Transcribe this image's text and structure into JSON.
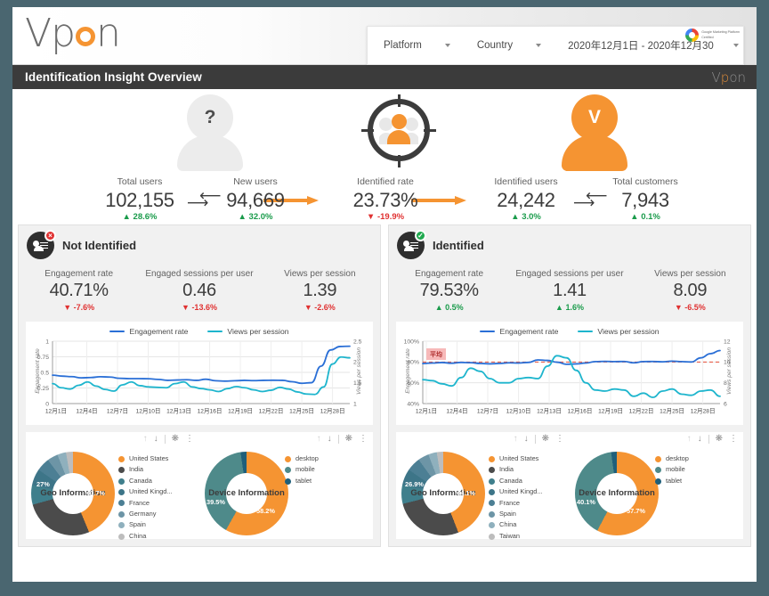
{
  "brand": {
    "logo": "Vpon",
    "accent": "#f59432",
    "title_logo": "Vpon"
  },
  "header": {
    "certification": {
      "line1": "Google Marketing Platform",
      "line2": "Certified"
    },
    "filters": [
      {
        "name": "platform",
        "label": "Platform"
      },
      {
        "name": "country",
        "label": "Country"
      },
      {
        "name": "date-range",
        "label": "2020年12月1日 - 2020年12月30"
      }
    ]
  },
  "page_title": "Identification Insight Overview",
  "funnel": {
    "icons": [
      {
        "name": "unknown-user-icon",
        "glyph": "?"
      },
      {
        "name": "targeted-users-icon",
        "glyph": ""
      },
      {
        "name": "identified-user-icon",
        "glyph": "V"
      }
    ],
    "kpis": [
      {
        "label": "Total users",
        "value": "102,155",
        "delta": "28.6%",
        "dir": "up"
      },
      {
        "label": "New users",
        "value": "94,669",
        "delta": "32.0%",
        "dir": "up"
      },
      {
        "label": "Identified rate",
        "value": "23.73%",
        "delta": "-19.9%",
        "dir": "down"
      },
      {
        "label": "Identified users",
        "value": "24,242",
        "delta": "3.0%",
        "dir": "up"
      },
      {
        "label": "Total customers",
        "value": "7,943",
        "delta": "0.1%",
        "dir": "up"
      }
    ]
  },
  "panels": [
    {
      "id": "not-identified",
      "title": "Not Identified",
      "status": "x",
      "kpis": [
        {
          "label": "Engagement rate",
          "value": "40.71%",
          "delta": "-7.6%",
          "dir": "down"
        },
        {
          "label": "Engaged sessions per user",
          "value": "0.46",
          "delta": "-13.6%",
          "dir": "down"
        },
        {
          "label": "Views per session",
          "value": "1.39",
          "delta": "-2.6%",
          "dir": "down"
        }
      ],
      "chart_data": {
        "type": "line",
        "title": "",
        "legend": [
          "Engagement rate",
          "Views per session"
        ],
        "legend_position": "top",
        "grid": true,
        "xlabel": "",
        "ylabel": "Engagement rate",
        "y2label": "Views per session",
        "ylim": [
          0,
          1
        ],
        "yticks": [
          "0",
          "0.25",
          "0.5",
          "0.75",
          "1"
        ],
        "y2lim": [
          1,
          2.5
        ],
        "y2ticks": [
          "1",
          "1.5",
          "2",
          "2.5"
        ],
        "xticks": [
          "12月1日",
          "12月4日",
          "12月7日",
          "12月10日",
          "12月13日",
          "12月16日",
          "12月19日",
          "12月22日",
          "12月25日",
          "12月28日"
        ],
        "series": [
          {
            "name": "Engagement rate",
            "color": "#2a6fd6",
            "values": [
              0.455,
              0.44,
              0.432,
              0.412,
              0.418,
              0.43,
              0.425,
              0.405,
              0.4,
              0.4,
              0.398,
              0.388,
              0.372,
              0.378,
              0.382,
              0.372,
              0.39,
              0.366,
              0.36,
              0.366,
              0.372,
              0.368,
              0.372,
              0.374,
              0.372,
              0.35,
              0.325,
              0.335,
              0.6,
              0.86,
              0.915,
              0.92
            ]
          },
          {
            "name": "Views per session",
            "color": "#1eb5cd",
            "values": [
              1.48,
              1.38,
              1.35,
              1.44,
              1.52,
              1.42,
              1.34,
              1.3,
              1.45,
              1.52,
              1.43,
              1.4,
              1.39,
              1.38,
              1.48,
              1.52,
              1.4,
              1.36,
              1.33,
              1.29,
              1.36,
              1.41,
              1.38,
              1.33,
              1.29,
              1.32,
              1.39,
              1.35,
              1.28,
              1.23,
              1.22,
              1.4,
              1.95,
              2.12,
              2.1
            ]
          }
        ]
      },
      "geo": {
        "title": "Geo Information",
        "chart_data": {
          "type": "pie",
          "title": "Geo Information",
          "labels": [
            "United States",
            "India",
            "Canada",
            "United Kingd...",
            "France",
            "Germany",
            "Spain",
            "China"
          ],
          "values": [
            43.7,
            27.0,
            7.6,
            6.3,
            5.2,
            4.1,
            3.4,
            2.7
          ],
          "annotations": [
            "43.7%",
            "27%"
          ],
          "colors": [
            "#f59432",
            "#4b4b4b",
            "#3f7f8c",
            "#3d7588",
            "#4c7f94",
            "#6d95a6",
            "#8fb0bd",
            "#bdbdbd"
          ]
        }
      },
      "device": {
        "title": "Device Information",
        "chart_data": {
          "type": "pie",
          "title": "Device Information",
          "labels": [
            "desktop",
            "mobile",
            "tablet"
          ],
          "values": [
            58.2,
            39.5,
            2.3
          ],
          "annotations": [
            "58.2%",
            "39.5%"
          ],
          "colors": [
            "#f59432",
            "#4e8a8a",
            "#1f5f7a"
          ]
        }
      }
    },
    {
      "id": "identified",
      "title": "Identified",
      "status": "ok",
      "kpis": [
        {
          "label": "Engagement rate",
          "value": "79.53%",
          "delta": "0.5%",
          "dir": "up"
        },
        {
          "label": "Engaged sessions per user",
          "value": "1.41",
          "delta": "1.6%",
          "dir": "up"
        },
        {
          "label": "Views per session",
          "value": "8.09",
          "delta": "-6.5%",
          "dir": "down"
        }
      ],
      "chart_data": {
        "type": "line",
        "title": "",
        "legend": [
          "Engagement rate",
          "Views per session"
        ],
        "legend_position": "top",
        "grid": true,
        "average_label": "平均",
        "average_value": 80,
        "xlabel": "",
        "ylabel": "Engagement rate",
        "y2label": "Views per session",
        "ylim": [
          40,
          100
        ],
        "yticks": [
          "40%",
          "60%",
          "80%",
          "100%"
        ],
        "y2lim": [
          6,
          12
        ],
        "y2ticks": [
          "6",
          "8",
          "10",
          "12"
        ],
        "xticks": [
          "12月1日",
          "12月4日",
          "12月7日",
          "12月10日",
          "12月13日",
          "12月16日",
          "12月19日",
          "12月22日",
          "12月25日",
          "12月28日"
        ],
        "series": [
          {
            "name": "Engagement rate",
            "color": "#2a6fd6",
            "values": [
              78.5,
              79.0,
              79.5,
              78.8,
              79.6,
              79.3,
              78.6,
              78.2,
              78.6,
              79.2,
              79.0,
              79.6,
              82.0,
              81.5,
              79.8,
              77.8,
              78.2,
              79.0,
              80.4,
              80.6,
              80.4,
              80.5,
              79.2,
              80.4,
              80.5,
              80.2,
              80.8,
              80.4,
              80.0,
              84.0,
              88.0,
              91.0
            ]
          },
          {
            "name": "Views per session",
            "color": "#1eb5cd",
            "values": [
              8.3,
              8.2,
              7.9,
              7.7,
              8.5,
              9.4,
              9.1,
              8.4,
              8.0,
              8.0,
              8.4,
              8.5,
              8.4,
              9.6,
              10.6,
              10.4,
              9.2,
              8.0,
              7.3,
              7.2,
              7.4,
              7.3,
              6.7,
              7.0,
              6.6,
              7.2,
              7.4,
              6.9,
              6.8,
              7.2,
              7.3,
              6.7
            ]
          }
        ]
      },
      "geo": {
        "title": "Geo Information",
        "chart_data": {
          "type": "pie",
          "title": "Geo Information",
          "labels": [
            "United States",
            "India",
            "Canada",
            "United Kingd...",
            "France",
            "Spain",
            "China",
            "Taiwan"
          ],
          "values": [
            44.1,
            26.9,
            7.4,
            6.2,
            5.4,
            4.2,
            3.3,
            2.5
          ],
          "annotations": [
            "44.1%",
            "26.9%"
          ],
          "colors": [
            "#f59432",
            "#4b4b4b",
            "#3f7f8c",
            "#3d7588",
            "#4c7f94",
            "#6d95a6",
            "#8fb0bd",
            "#bdbdbd"
          ]
        }
      },
      "device": {
        "title": "Device Information",
        "chart_data": {
          "type": "pie",
          "title": "Device Information",
          "labels": [
            "desktop",
            "mobile",
            "tablet"
          ],
          "values": [
            57.7,
            40.1,
            2.2
          ],
          "annotations": [
            "57.7%",
            "40.1%"
          ],
          "colors": [
            "#f59432",
            "#4e8a8a",
            "#1f5f7a"
          ]
        }
      }
    }
  ],
  "toolbar_icons": [
    "sort-ascending-icon",
    "sort-descending-icon",
    "compare-icon",
    "more-options-icon"
  ]
}
